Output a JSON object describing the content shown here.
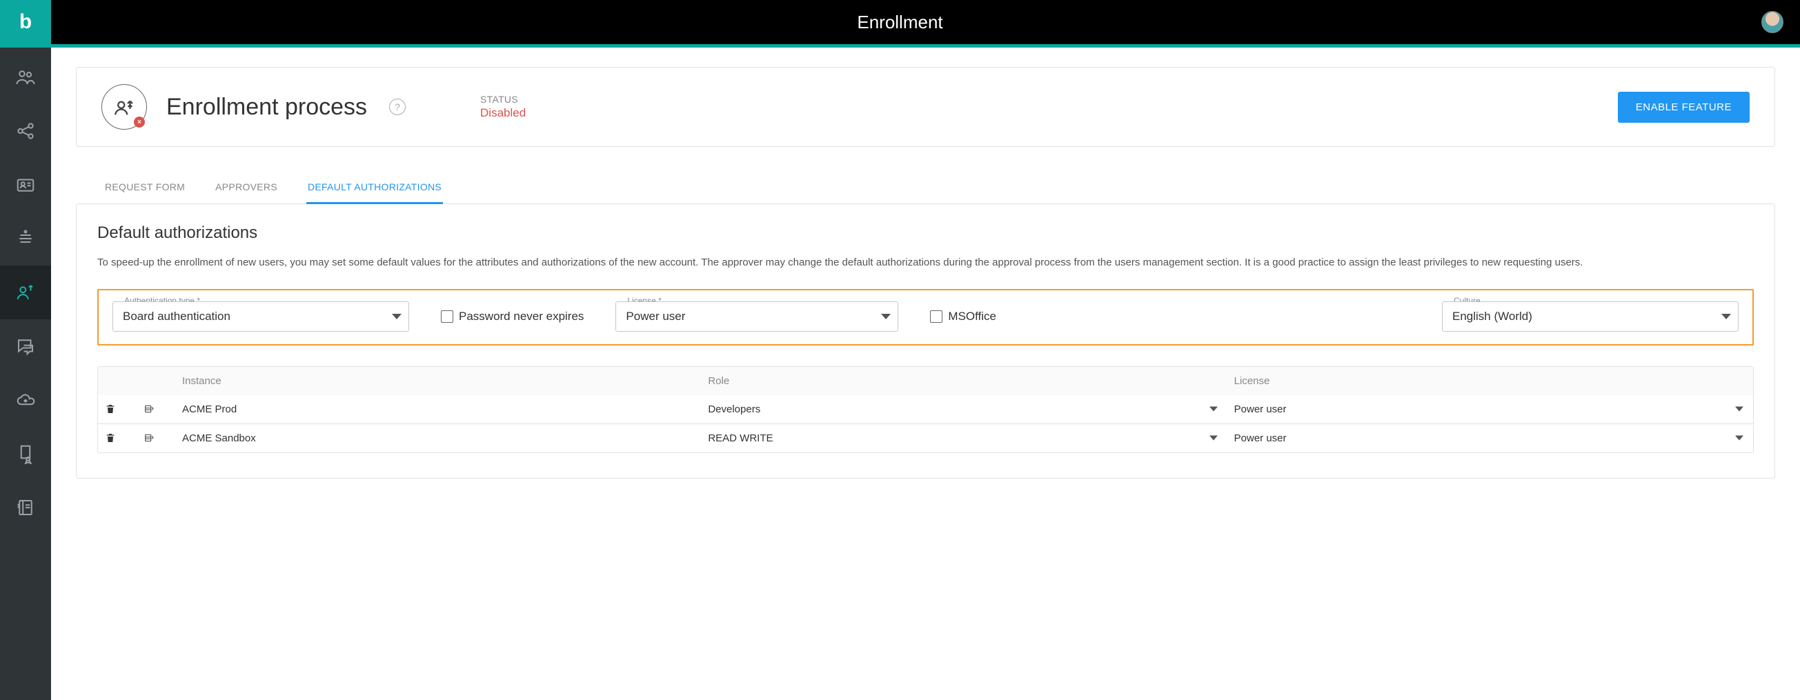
{
  "topbar": {
    "title": "Enrollment"
  },
  "header": {
    "title": "Enrollment process",
    "status_label": "STATUS",
    "status_value": "Disabled",
    "enable_button": "ENABLE FEATURE"
  },
  "tabs": [
    {
      "label": "REQUEST FORM"
    },
    {
      "label": "APPROVERS"
    },
    {
      "label": "DEFAULT AUTHORIZATIONS"
    }
  ],
  "panel": {
    "heading": "Default authorizations",
    "description": "To speed-up the enrollment of new users, you may set some default values for the attributes and authorizations of the new account. The approver may change the default authorizations during the approval process from the users management section. It is a good practice to assign the least privileges to new requesting users."
  },
  "config": {
    "auth_label": "Authentication type *",
    "auth_value": "Board authentication",
    "pwd_never_expires": "Password never expires",
    "license_label": "License *",
    "license_value": "Power user",
    "msoffice": "MSOffice",
    "culture_label": "Culture",
    "culture_value": "English (World)"
  },
  "table": {
    "columns": {
      "instance": "Instance",
      "role": "Role",
      "license": "License"
    },
    "rows": [
      {
        "instance": "ACME Prod",
        "role": "Developers",
        "license": "Power user"
      },
      {
        "instance": "ACME Sandbox",
        "role": "READ WRITE",
        "license": "Power user"
      }
    ]
  }
}
